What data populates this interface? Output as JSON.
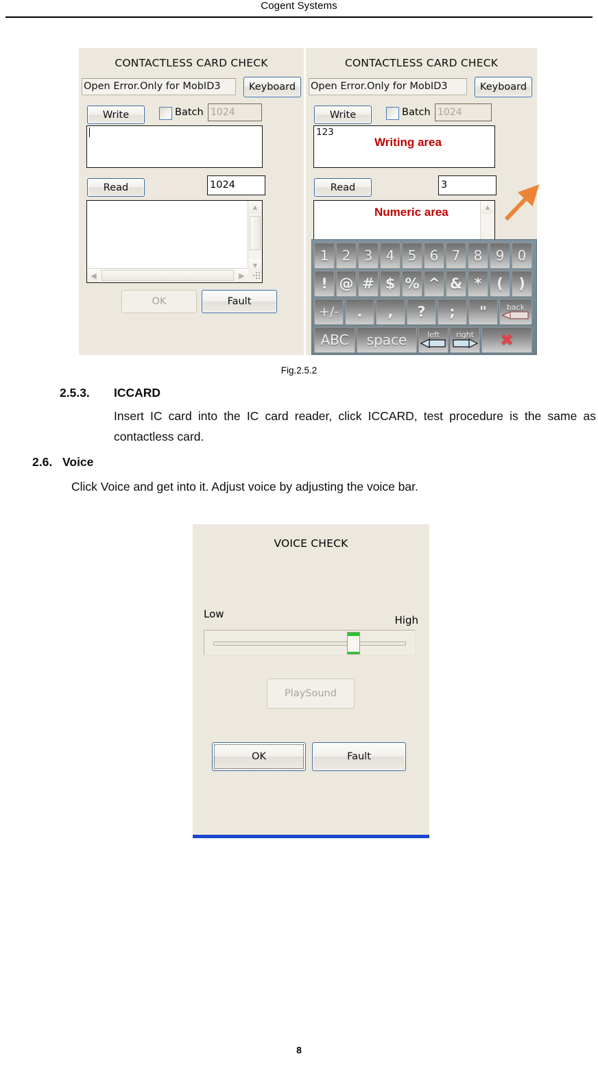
{
  "header": {
    "title": "Cogent Systems"
  },
  "footer": {
    "page_number": "8"
  },
  "figures": {
    "fig252": {
      "caption": "Fig.2.5.2",
      "panel_left": {
        "title": "CONTACTLESS CARD CHECK",
        "status_text": "Open Error.Only for MobID3",
        "keyboard_button": "Keyboard",
        "write_button": "Write",
        "batch_label": "Batch",
        "batch_value": "1024",
        "write_textarea_value": "",
        "read_button": "Read",
        "read_count_value": "1024",
        "output_value": "",
        "ok_button": "OK",
        "fault_button": "Fault"
      },
      "panel_right": {
        "title": "CONTACTLESS CARD CHECK",
        "status_text": "Open Error.Only for MobID3",
        "keyboard_button": "Keyboard",
        "write_button": "Write",
        "batch_label": "Batch",
        "batch_value": "1024",
        "write_textarea_value": "123",
        "read_button": "Read",
        "read_count_value": "3",
        "annotation_writing_area": "Writing area",
        "annotation_numeric_area": "Numeric area",
        "annotation_color": "#c00000",
        "arrow_color": "#ec8438"
      },
      "keyboard": {
        "row1": [
          "1",
          "2",
          "3",
          "4",
          "5",
          "6",
          "7",
          "8",
          "9",
          "0"
        ],
        "row2": [
          "!",
          "@",
          "#",
          "$",
          "%",
          "^",
          "&",
          "*",
          "(",
          ")"
        ],
        "row3": [
          "+/-",
          ".",
          ",",
          "?",
          ";",
          "\"",
          "back"
        ],
        "row4": [
          "ABC",
          "space",
          "left",
          "right",
          "✖"
        ]
      }
    },
    "voice_check": {
      "title": "VOICE CHECK",
      "low_label": "Low",
      "high_label": "High",
      "slider_position_percent": 70,
      "play_sound_button": "PlaySound",
      "ok_button": "OK",
      "fault_button": "Fault",
      "accent_bar_color": "#1944cc",
      "slider_thumb_color": "#2fc12f"
    }
  },
  "sections": [
    {
      "number": "2.5.3.",
      "heading": "ICCARD",
      "body": "Insert IC card into the IC card reader, click ICCARD, test procedure is the same as contactless card."
    },
    {
      "number": "2.6.",
      "heading": "Voice",
      "body": "Click Voice and get into it. Adjust voice by adjusting the voice bar."
    }
  ]
}
